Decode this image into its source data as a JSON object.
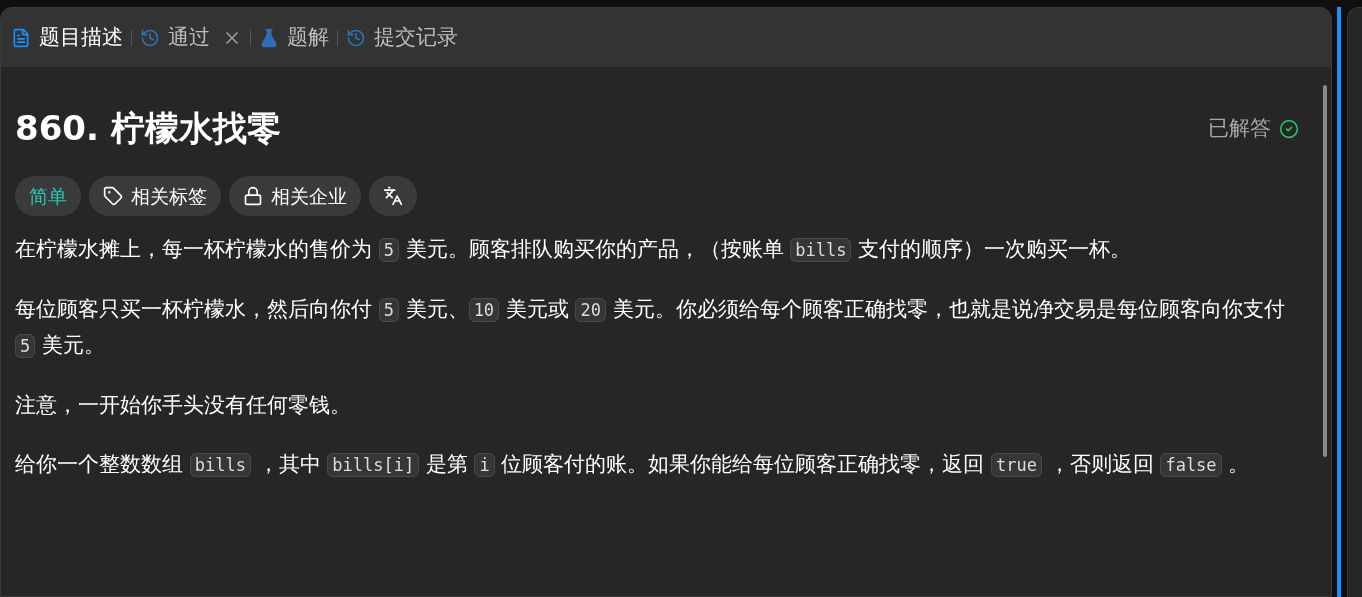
{
  "tabs": [
    {
      "label": "题目描述",
      "selected": true,
      "closable": false
    },
    {
      "label": "通过",
      "selected": false,
      "closable": true
    },
    {
      "label": "题解",
      "selected": false,
      "closable": false
    },
    {
      "label": "提交记录",
      "selected": false,
      "closable": false
    }
  ],
  "problem": {
    "title": "860. 柠檬水找零",
    "status": "已解答",
    "solved": true
  },
  "tags": [
    {
      "label": "简单",
      "kind": "difficulty"
    },
    {
      "label": "相关标签",
      "kind": "topics"
    },
    {
      "label": "相关企业",
      "kind": "companies"
    },
    {
      "kind": "translate"
    }
  ],
  "paragraphs": [
    [
      {
        "kind": "text",
        "text": "在柠檬水摊上，每一杯柠檬水的售价为 "
      },
      {
        "kind": "code",
        "text": "5"
      },
      {
        "kind": "text",
        "text": " 美元。顾客排队购买你的产品，（按账单 "
      },
      {
        "kind": "code",
        "text": "bills"
      },
      {
        "kind": "text",
        "text": " 支付的顺序）一次购买一杯。"
      }
    ],
    [
      {
        "kind": "text",
        "text": "每位顾客只买一杯柠檬水，然后向你付 "
      },
      {
        "kind": "code",
        "text": "5"
      },
      {
        "kind": "text",
        "text": " 美元、"
      },
      {
        "kind": "code",
        "text": "10"
      },
      {
        "kind": "text",
        "text": " 美元或 "
      },
      {
        "kind": "code",
        "text": "20"
      },
      {
        "kind": "text",
        "text": " 美元。你必须给每个顾客正确找零，也就是说净交易是每位顾客向你支付 "
      },
      {
        "kind": "code",
        "text": "5"
      },
      {
        "kind": "text",
        "text": " 美元。"
      }
    ],
    [
      {
        "kind": "text",
        "text": "注意，一开始你手头没有任何零钱。"
      }
    ],
    [
      {
        "kind": "text",
        "text": "给你一个整数数组 "
      },
      {
        "kind": "code",
        "text": "bills"
      },
      {
        "kind": "text",
        "text": " ，其中 "
      },
      {
        "kind": "code",
        "text": "bills[i]"
      },
      {
        "kind": "text",
        "text": " 是第 "
      },
      {
        "kind": "code",
        "text": "i"
      },
      {
        "kind": "text",
        "text": " 位顾客付的账。如果你能给每位顾客正确找零，返回 "
      },
      {
        "kind": "code",
        "text": "true"
      },
      {
        "kind": "text",
        "text": " ，否则返回 "
      },
      {
        "kind": "code",
        "text": "false"
      },
      {
        "kind": "text",
        "text": " 。"
      }
    ]
  ]
}
